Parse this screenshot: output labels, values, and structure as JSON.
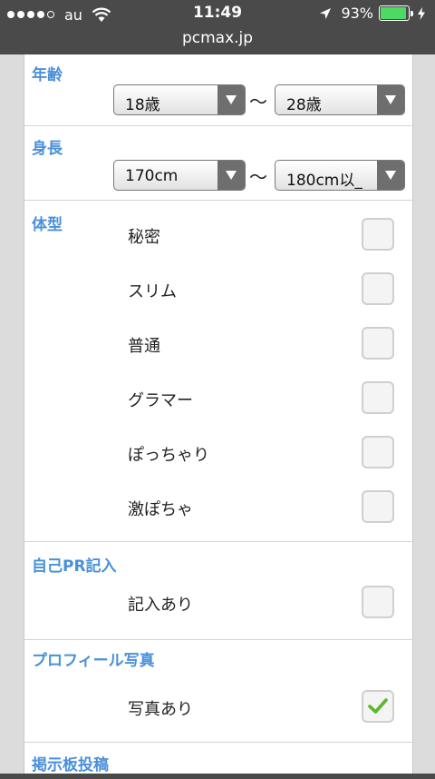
{
  "status_bar": {
    "carrier": "au",
    "time": "11:49",
    "battery_percent": "93%",
    "battery_level": 0.93,
    "url": "pcmax.jp"
  },
  "sections": {
    "age": {
      "title": "年齢",
      "from": "18歳",
      "separator": "〜",
      "to": "28歳"
    },
    "height": {
      "title": "身長",
      "from": "170cm",
      "separator": "〜",
      "to": "180cm以_"
    },
    "body_type": {
      "title": "体型",
      "options": [
        {
          "label": "秘密",
          "checked": false
        },
        {
          "label": "スリム",
          "checked": false
        },
        {
          "label": "普通",
          "checked": false
        },
        {
          "label": "グラマー",
          "checked": false
        },
        {
          "label": "ぽっちゃり",
          "checked": false
        },
        {
          "label": "激ぽちゃ",
          "checked": false
        }
      ]
    },
    "self_pr": {
      "title": "自己PR記入",
      "option": {
        "label": "記入あり",
        "checked": false
      }
    },
    "profile_photo": {
      "title": "プロフィール写真",
      "option": {
        "label": "写真あり",
        "checked": true
      }
    },
    "board_post": {
      "title": "掲示板投稿"
    }
  },
  "colors": {
    "section_title": "#4a90d9",
    "check_mark": "#5cb82e",
    "battery": "#4cd964"
  }
}
